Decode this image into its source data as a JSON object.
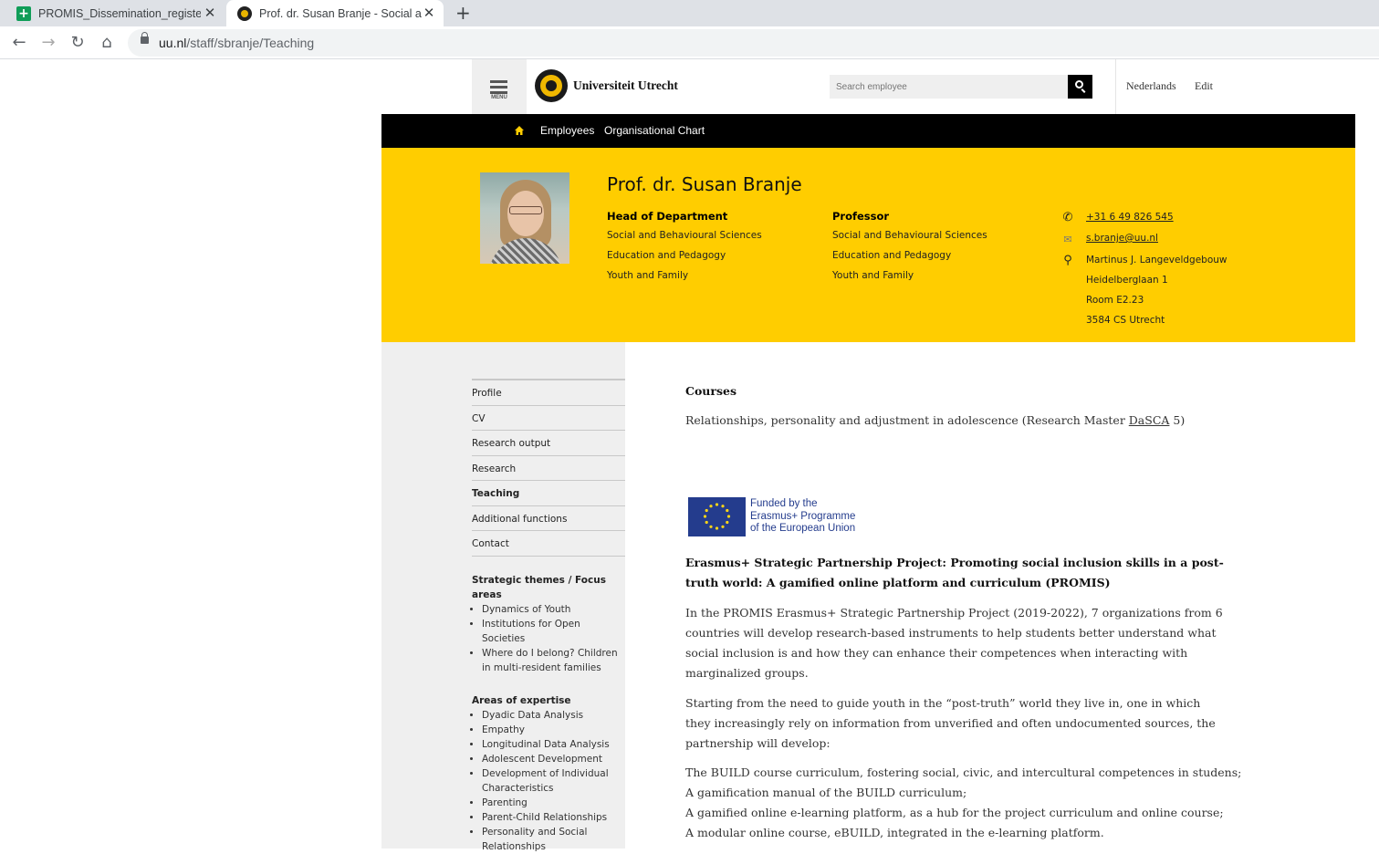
{
  "browser": {
    "tabs": [
      {
        "title": "PROMIS_Dissemination_register.xlsx",
        "active": false
      },
      {
        "title": "Prof. dr. Susan Branje - Social and Behavioural Sciences",
        "active": true
      }
    ],
    "url_host": "uu.nl",
    "url_path": "/staff/sbranje/Teaching"
  },
  "header": {
    "menu_label": "MENU",
    "logo_text": "Universiteit Utrecht",
    "search_placeholder": "Search employee",
    "language_link": "Nederlands",
    "edit_link": "Edit"
  },
  "navbar": {
    "links": [
      "Employees",
      "Organisational Chart"
    ]
  },
  "profile": {
    "name": "Prof. dr. Susan Branje",
    "roles": [
      {
        "title": "Head of Department",
        "lines": [
          "Social and Behavioural Sciences",
          "Education and Pedagogy",
          "Youth and Family"
        ]
      },
      {
        "title": "Professor",
        "lines": [
          "Social and Behavioural Sciences",
          "Education and Pedagogy",
          "Youth and Family"
        ]
      }
    ],
    "phone": "+31 6 49 826 545",
    "email": "s.branje@uu.nl",
    "address": [
      "Martinus J. Langeveldgebouw",
      "Heidelberglaan 1",
      "Room E2.23",
      "3584 CS Utrecht"
    ]
  },
  "sidebar": {
    "items": [
      "Profile",
      "CV",
      "Research output",
      "Research",
      "Teaching",
      "Additional functions",
      "Contact"
    ],
    "active_item": "Teaching",
    "themes_heading": "Strategic themes / Focus areas",
    "themes": [
      "Dynamics of Youth",
      "Institutions for Open Societies",
      "Where do I belong? Children in multi-resident families"
    ],
    "expertise_heading": "Areas of expertise",
    "expertise": [
      "Dyadic Data Analysis",
      "Empathy",
      "Longitudinal Data Analysis",
      "Adolescent Development",
      "Development of Individual Characteristics",
      "Parenting",
      "Parent-Child Relationships",
      "Personality and Social Relationships"
    ]
  },
  "main": {
    "courses_heading": "Courses",
    "course_prefix": "Relationships, personality and adjustment in adolescence (Research Master ",
    "course_link": "DaSCA",
    "course_suffix": " 5)",
    "eu_logo_lines": [
      "Funded by the",
      "Erasmus+ Programme",
      "of the European Union"
    ],
    "project_title": "Erasmus+ Strategic Partnership Project: Promoting social inclusion skills in a post-truth world: A gamified online platform and curriculum (PROMIS)",
    "paragraph1": "In the PROMIS Erasmus+ Strategic Partnership Project (2019-2022), 7 organizations from 6 countries will develop research-based instruments to help students better understand what social inclusion is and how they can enhance their competences when interacting with marginalized groups.",
    "paragraph2": "Starting from the need to guide youth in the “post-truth” world they live in, one in which they increasingly rely on information from unverified and often undocumented sources, the partnership will develop:",
    "deliverables": [
      "The BUILD course curriculum, fostering social, civic, and intercultural competences in studens;",
      "A gamification manual of the BUILD curriculum;",
      "A gamified online e-learning platform, as a hub for the project curriculum and online course;",
      "A modular online course, eBUILD, integrated in the e-learning platform."
    ]
  },
  "colors": {
    "brand_yellow": "#ffcd00",
    "nav_black": "#000000",
    "sidebar_gray": "#efefef",
    "eu_blue": "#243c8d"
  }
}
